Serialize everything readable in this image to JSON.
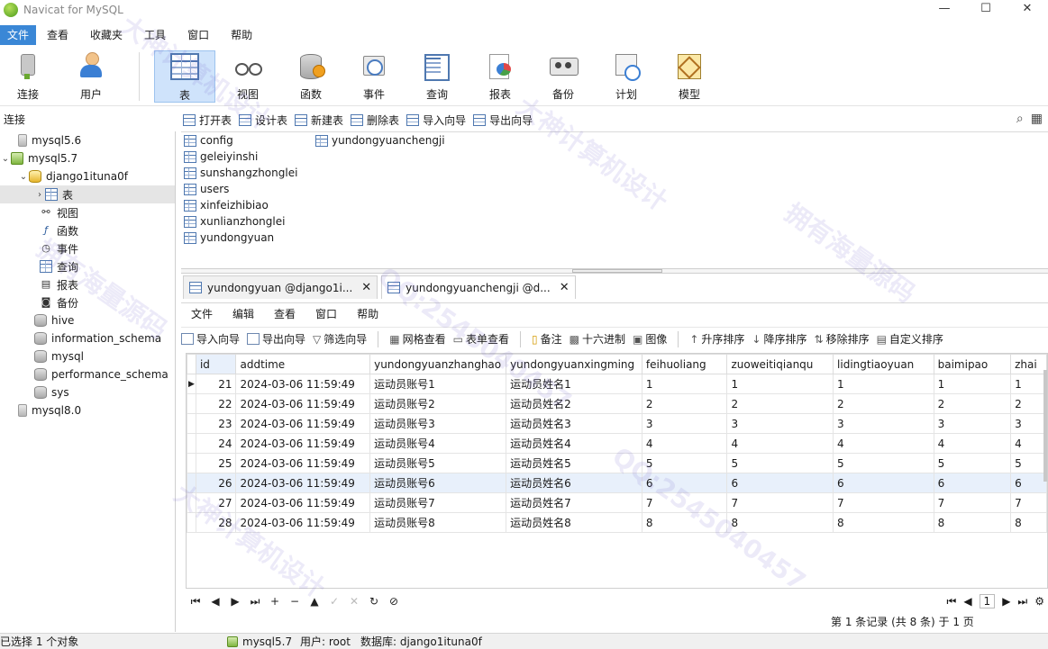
{
  "app": {
    "title": "Navicat for MySQL",
    "window_buttons": [
      "—",
      "☐",
      "✕"
    ]
  },
  "menu": [
    "文件",
    "查看",
    "收藏夹",
    "工具",
    "窗口",
    "帮助"
  ],
  "toolbar": {
    "connect": "连接",
    "user": "用户",
    "table": "表",
    "view": "视图",
    "function": "函数",
    "event": "事件",
    "query": "查询",
    "report": "报表",
    "backup": "备份",
    "schedule": "计划",
    "model": "模型"
  },
  "connections_label": "连接",
  "tree": {
    "mysql56": "mysql5.6",
    "mysql57": "mysql5.7",
    "db": "django1ituna0f",
    "tables": "表",
    "views": "视图",
    "functions": "函数",
    "events": "事件",
    "queries": "查询",
    "reports": "报表",
    "backups": "备份",
    "hive": "hive",
    "information_schema": "information_schema",
    "mysql": "mysql",
    "performance_schema": "performance_schema",
    "sys": "sys",
    "mysql80": "mysql8.0"
  },
  "object_toolbar": [
    "打开表",
    "设计表",
    "新建表",
    "删除表",
    "导入向导",
    "导出向导"
  ],
  "objects": [
    "config",
    "geleiyinshi",
    "sunshangzhonglei",
    "users",
    "xinfeizhibiao",
    "xunlianzhonglei",
    "yundongyuan",
    "yundongyuanchengji"
  ],
  "tabs": [
    {
      "label": "yundongyuan @django1i...",
      "close": "✕"
    },
    {
      "label": "yundongyuanchengji @d...",
      "close": "✕"
    }
  ],
  "tab_menu": [
    "文件",
    "编辑",
    "查看",
    "窗口",
    "帮助"
  ],
  "data_toolbar": [
    "导入向导",
    "导出向导",
    "筛选向导",
    "网格查看",
    "表单查看",
    "备注",
    "十六进制",
    "图像",
    "升序排序",
    "降序排序",
    "移除排序",
    "自定义排序"
  ],
  "columns": [
    "id",
    "addtime",
    "yundongyuanzhanghao",
    "yundongyuanxingming",
    "feihuoliang",
    "zuoweitiqianqu",
    "lidingtiaoyuan",
    "baimipao",
    "zhai"
  ],
  "rows": [
    [
      "21",
      "2024-03-06 11:59:49",
      "运动员账号1",
      "运动员姓名1",
      "1",
      "1",
      "1",
      "1",
      "1"
    ],
    [
      "22",
      "2024-03-06 11:59:49",
      "运动员账号2",
      "运动员姓名2",
      "2",
      "2",
      "2",
      "2",
      "2"
    ],
    [
      "23",
      "2024-03-06 11:59:49",
      "运动员账号3",
      "运动员姓名3",
      "3",
      "3",
      "3",
      "3",
      "3"
    ],
    [
      "24",
      "2024-03-06 11:59:49",
      "运动员账号4",
      "运动员姓名4",
      "4",
      "4",
      "4",
      "4",
      "4"
    ],
    [
      "25",
      "2024-03-06 11:59:49",
      "运动员账号5",
      "运动员姓名5",
      "5",
      "5",
      "5",
      "5",
      "5"
    ],
    [
      "26",
      "2024-03-06 11:59:49",
      "运动员账号6",
      "运动员姓名6",
      "6",
      "6",
      "6",
      "6",
      "6"
    ],
    [
      "27",
      "2024-03-06 11:59:49",
      "运动员账号7",
      "运动员姓名7",
      "7",
      "7",
      "7",
      "7",
      "7"
    ],
    [
      "28",
      "2024-03-06 11:59:49",
      "运动员账号8",
      "运动员姓名8",
      "8",
      "8",
      "8",
      "8",
      "8"
    ]
  ],
  "nav_buttons": [
    "⏮",
    "◀",
    "▶",
    "⏭",
    "+",
    "−",
    "▲",
    "✓",
    "✕",
    "↻",
    "⊘"
  ],
  "pager": {
    "page": "1"
  },
  "record_info": "第 1 条记录 (共 8 条) 于 1 页",
  "status": {
    "selection": "已选择 1 个对象",
    "server": "mysql5.7",
    "user": "用户: root",
    "database": "数据库: django1ituna0f"
  },
  "watermarks": [
    "大神计算机设计",
    "拥有海量源码",
    "QQ:2545040457"
  ]
}
